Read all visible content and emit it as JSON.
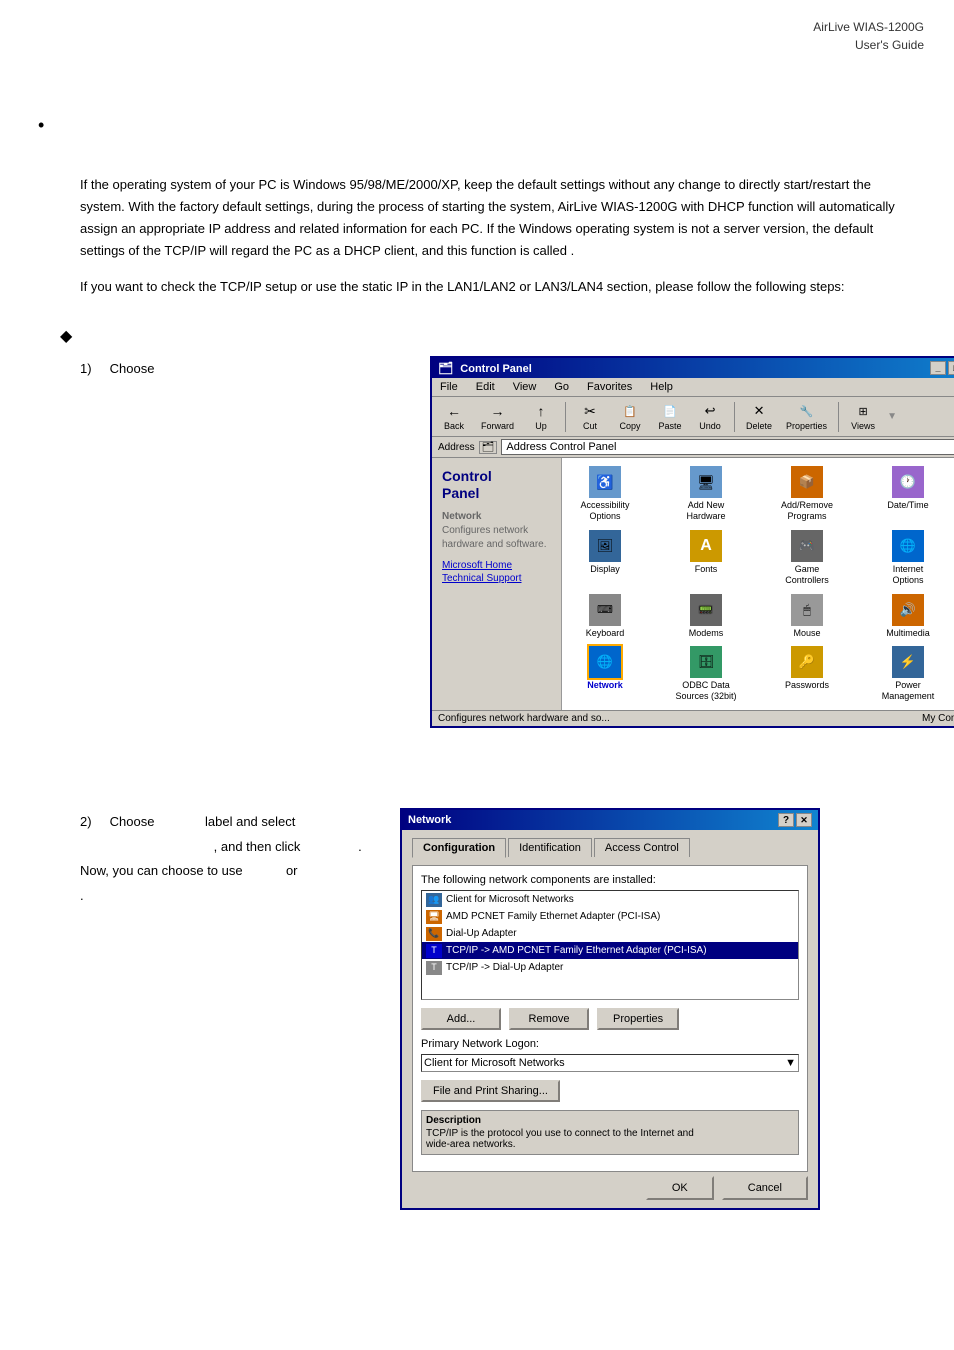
{
  "header": {
    "line1": "AirLive  WIAS-1200G",
    "line2": "User's  Guide"
  },
  "intro": {
    "paragraph1": "If the operating system of your PC is Windows 95/98/ME/2000/XP, keep the default settings without any change to directly start/restart the system. With the factory default settings, during the process of starting the system, AirLive WIAS-1200G with DHCP function will automatically assign an appropriate IP address and related information for each PC. If the Windows operating system is not a server version, the default settings of the TCP/IP will regard the PC as a DHCP client, and this function is called                                                                          .",
    "paragraph2": "If you want to check the TCP/IP setup or use the static IP in the LAN1/LAN2 or LAN3/LAN4 section, please follow the following steps:"
  },
  "step1": {
    "number": "1)",
    "label": "Choose",
    "trailing": "."
  },
  "step2": {
    "number": "2)",
    "label": "Choose",
    "middle": "label and select",
    "line2": ", and then click",
    "line2_end": ".",
    "line3": "Now, you can choose to use",
    "line3_mid": "or",
    "line3_end": "."
  },
  "control_panel": {
    "title": "Control Panel",
    "address": "Address  Control Panel",
    "menu": [
      "File",
      "Edit",
      "View",
      "Go",
      "Favorites",
      "Help"
    ],
    "toolbar_buttons": [
      "Back",
      "Forward",
      "Up",
      "Cut",
      "Copy",
      "Paste",
      "Undo",
      "Delete",
      "Properties",
      "Views"
    ],
    "sidebar_title": "Control\nPanel",
    "sidebar_section": "Network\nConfigures network\nhardware and software.",
    "sidebar_links": [
      "Microsoft Home",
      "Technical Support"
    ],
    "icons": [
      {
        "label": "Accessibility\nOptions",
        "icon": "♿"
      },
      {
        "label": "Add New\nHardware",
        "icon": "🖥"
      },
      {
        "label": "Add/Remove\nPrograms",
        "icon": "📦"
      },
      {
        "label": "Date/Time",
        "icon": "📅"
      },
      {
        "label": "Display",
        "icon": "🖼"
      },
      {
        "label": "Fonts",
        "icon": "A"
      },
      {
        "label": "Game\nControllers",
        "icon": "🎮"
      },
      {
        "label": "Internet\nOptions",
        "icon": "🌐"
      },
      {
        "label": "Keyboard",
        "icon": "⌨"
      },
      {
        "label": "Modems",
        "icon": "📠"
      },
      {
        "label": "Mouse",
        "icon": "🖱"
      },
      {
        "label": "Multimedia",
        "icon": "🔊"
      },
      {
        "label": "Network",
        "icon": "🌐"
      },
      {
        "label": "ODBC Data\nSources (32bit)",
        "icon": "🗄"
      },
      {
        "label": "Passwords",
        "icon": "🔑"
      },
      {
        "label": "Power\nManagement",
        "icon": "⚡"
      }
    ],
    "statusbar": "Configures network hardware and so...",
    "statusbar_right": "My Computer"
  },
  "network_dialog": {
    "title": "Network",
    "tabs": [
      "Configuration",
      "Identification",
      "Access Control"
    ],
    "active_tab": "Configuration",
    "intro_text": "The following network components are installed:",
    "list_items": [
      {
        "label": "Client for Microsoft Networks",
        "selected": false
      },
      {
        "label": "AMD PCNET Family Ethernet Adapter (PCI-ISA)",
        "selected": false
      },
      {
        "label": "Dial-Up Adapter",
        "selected": false
      },
      {
        "label": "TCP/IP -> AMD PCNET Family Ethernet Adapter (PCI-ISA)",
        "selected": true
      },
      {
        "label": "TCP/IP -> Dial-Up Adapter",
        "selected": false
      }
    ],
    "buttons": [
      "Add...",
      "Remove",
      "Properties"
    ],
    "primary_logon_label": "Primary Network Logon:",
    "primary_logon_value": "Client for Microsoft Networks",
    "sharing_btn": "File and Print Sharing...",
    "description_title": "Description",
    "description_text": "TCP/IP is the protocol you use to connect to the Internet and\nwide-area networks.",
    "ok_label": "OK",
    "cancel_label": "Cancel"
  }
}
